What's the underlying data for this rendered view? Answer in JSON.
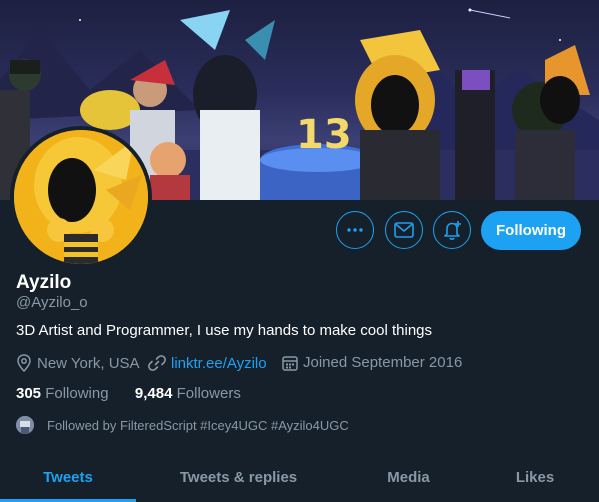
{
  "profile": {
    "name": "Ayzilo",
    "handle": "@Ayzilo_o",
    "bio": "3D Artist and Programmer, I use my hands to make cool things",
    "location": "New York, USA",
    "website": "linktr.ee/Ayzilo",
    "joined": "Joined September 2016"
  },
  "stats": {
    "following_count": "305",
    "following_label": "Following",
    "followers_count": "9,484",
    "followers_label": "Followers"
  },
  "followed_by": "Followed by FilteredScript #Icey4UGC #Ayzilo4UGC",
  "actions": {
    "follow_label": "Following",
    "more_icon": "more-icon",
    "message_icon": "mail-icon",
    "notify_icon": "bell-plus-icon"
  },
  "tabs": [
    {
      "label": "Tweets",
      "active": true
    },
    {
      "label": "Tweets & replies",
      "active": false
    },
    {
      "label": "Media",
      "active": false
    },
    {
      "label": "Likes",
      "active": false
    }
  ],
  "colors": {
    "background": "#15202b",
    "accent": "#1da1f2",
    "muted": "#8899a6"
  }
}
